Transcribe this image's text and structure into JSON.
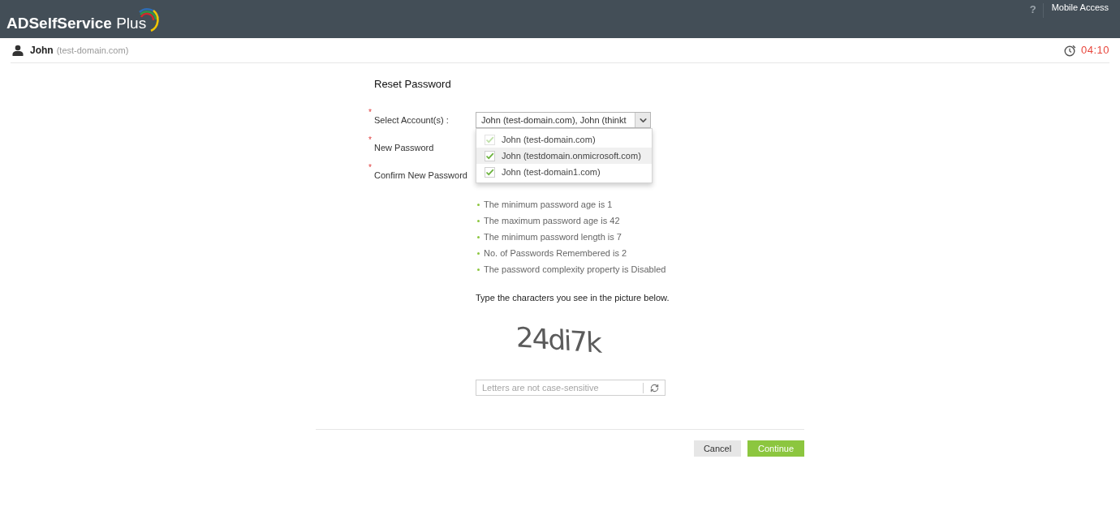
{
  "header": {
    "logo": "**ADSelfService** Plus",
    "help": "?",
    "mobile_access": "Mobile Access"
  },
  "user_bar": {
    "name": "John",
    "domain": "(test-domain.com)",
    "timer": "04:10"
  },
  "form": {
    "title": "Reset Password",
    "rows": [
      {
        "asterisk": "*",
        "label": "Select Account(s) :",
        "select": {
          "value": "John (test-domain.com), John (thinkt",
          "expanded": true,
          "options": [
            {
              "label": "John (test-domain.com)",
              "checked": true,
              "disabled": true,
              "highlighted": false
            },
            {
              "label": "John (testdomain.onmicrosoft.com)",
              "checked": true,
              "disabled": false,
              "highlighted": true
            },
            {
              "label": "John (test-domain1.com)",
              "checked": true,
              "disabled": false,
              "highlighted": false
            }
          ]
        }
      },
      {
        "asterisk": "*",
        "label": "New Password"
      },
      {
        "asterisk": "*",
        "label": "Confirm New Password"
      }
    ],
    "policy": [
      "The minimum password age is 1",
      "The maximum password age is 42",
      "The minimum password length is 7",
      "No. of Passwords Remembered is 2",
      "The password complexity property is Disabled"
    ],
    "captcha": {
      "instruction": "Type the characters you see in the picture below.",
      "text": "24di7k",
      "placeholder": "Letters are not case-sensitive"
    },
    "buttons": [
      {
        "label": "Cancel",
        "kind": "secondary"
      },
      {
        "label": "Continue",
        "kind": "primary"
      }
    ]
  }
}
